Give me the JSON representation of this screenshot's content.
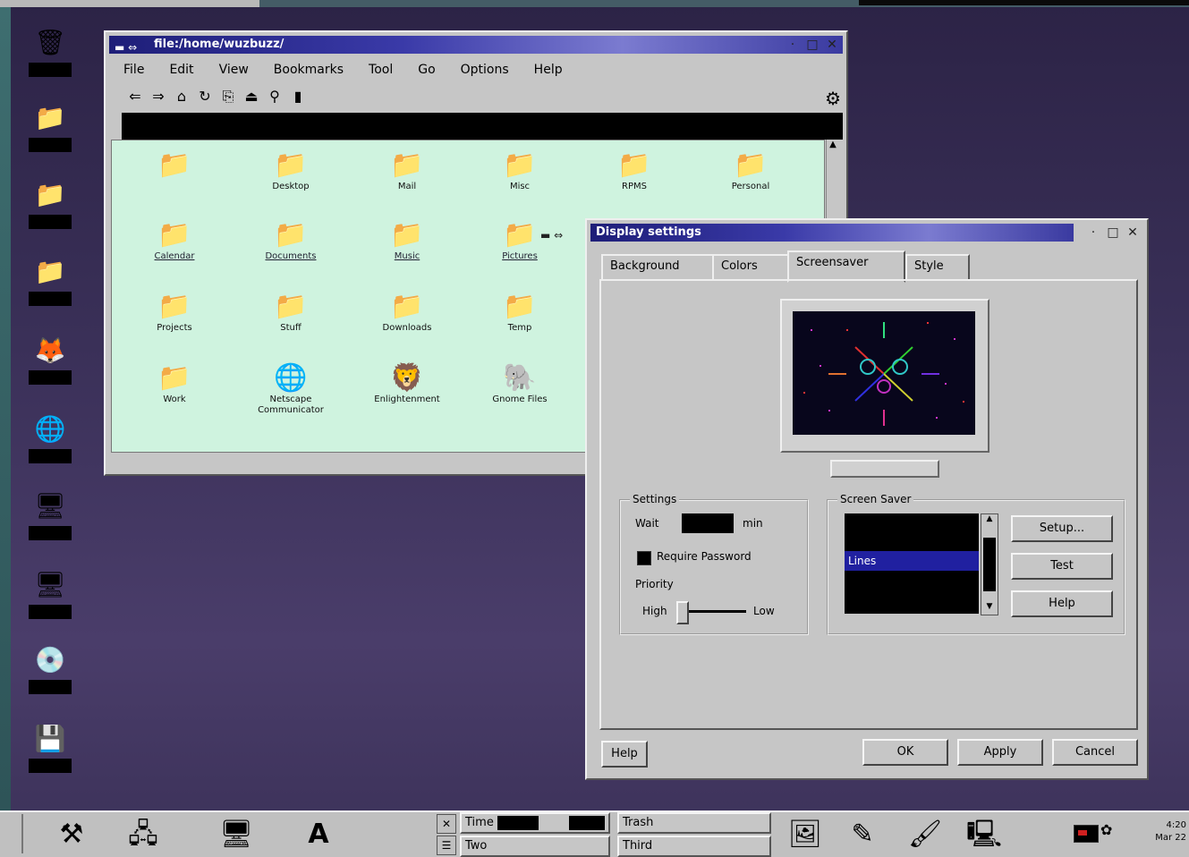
{
  "desktop": {
    "icons": [
      {
        "glyph": "🗑",
        "label": ""
      },
      {
        "glyph": "📁",
        "label": ""
      },
      {
        "glyph": "📁",
        "label": ""
      },
      {
        "glyph": "📁",
        "label": ""
      },
      {
        "glyph": "🦊",
        "label": ""
      },
      {
        "glyph": "🌐",
        "label": ""
      },
      {
        "glyph": "🖥",
        "label": ""
      },
      {
        "glyph": "🖥",
        "label": ""
      },
      {
        "glyph": "💿",
        "label": ""
      },
      {
        "glyph": "💾",
        "label": ""
      }
    ]
  },
  "file_manager": {
    "title": "file:/home/wuzbuzz/",
    "menu": [
      "File",
      "Edit",
      "View",
      "Bookmarks",
      "Tool",
      "Go",
      "Options",
      "Help"
    ],
    "toolbar_icons": [
      "back-icon",
      "forward-icon",
      "home-icon",
      "reload-icon",
      "copy-icon",
      "up-icon",
      "find-icon",
      "stop-icon"
    ],
    "files": [
      {
        "glyph": "📁",
        "label": "",
        "link": false
      },
      {
        "glyph": "📁",
        "label": "Desktop",
        "link": false
      },
      {
        "glyph": "📁",
        "label": "Mail",
        "link": false
      },
      {
        "glyph": "📁",
        "label": "Misc",
        "link": false
      },
      {
        "glyph": "📁",
        "label": "RPMS",
        "link": false
      },
      {
        "glyph": "📁",
        "label": "Personal",
        "link": false
      },
      {
        "glyph": "📁",
        "label": "Calendar",
        "link": true
      },
      {
        "glyph": "📁",
        "label": "Documents",
        "link": true
      },
      {
        "glyph": "📁",
        "label": "Music",
        "link": true
      },
      {
        "glyph": "📁",
        "label": "Pictures",
        "link": true
      },
      {
        "glyph": "📁",
        "label": "Projects",
        "link": false
      },
      {
        "glyph": "📁",
        "label": "Stuff",
        "link": false
      },
      {
        "glyph": "📁",
        "label": "Downloads",
        "link": false
      },
      {
        "glyph": "📁",
        "label": "Temp",
        "link": false
      },
      {
        "glyph": "📁",
        "label": "Work",
        "link": false
      },
      {
        "glyph": "🌐",
        "label": "Netscape Communicator",
        "link": false
      },
      {
        "glyph": "🦁",
        "label": "Enlightenment",
        "link": false
      },
      {
        "glyph": "🐘",
        "label": "Gnome Files",
        "link": false
      }
    ]
  },
  "display_settings": {
    "title": "Display settings",
    "tabs": [
      "Background",
      "Colors",
      "Screensaver",
      "Style"
    ],
    "active_tab": "Screensaver",
    "settings_group": "Settings",
    "wait_label": "Wait",
    "wait_unit": "min",
    "require_password": "Require Password",
    "priority_label": "Priority",
    "priority_low": "Low",
    "priority_high": "High",
    "screensaver_group": "Screen Saver",
    "screensaver_selected": "Lines",
    "setup_button": "Setup...",
    "test_button": "Test",
    "help_small_button": "Help",
    "help_button": "Help",
    "ok_button": "OK",
    "apply_button": "Apply",
    "cancel_button": "Cancel"
  },
  "taskbar": {
    "launchers": [
      "tool-icon",
      "network-icon",
      "computer-icon",
      "font-icon"
    ],
    "tasks": [
      "Time",
      "Trash",
      "Two",
      "Third"
    ],
    "tray_icons": [
      "monitor-icon",
      "editor-icon",
      "paint-icon",
      "terminal-icon"
    ],
    "clock_time": "4:20",
    "clock_date": "Mar 22"
  }
}
